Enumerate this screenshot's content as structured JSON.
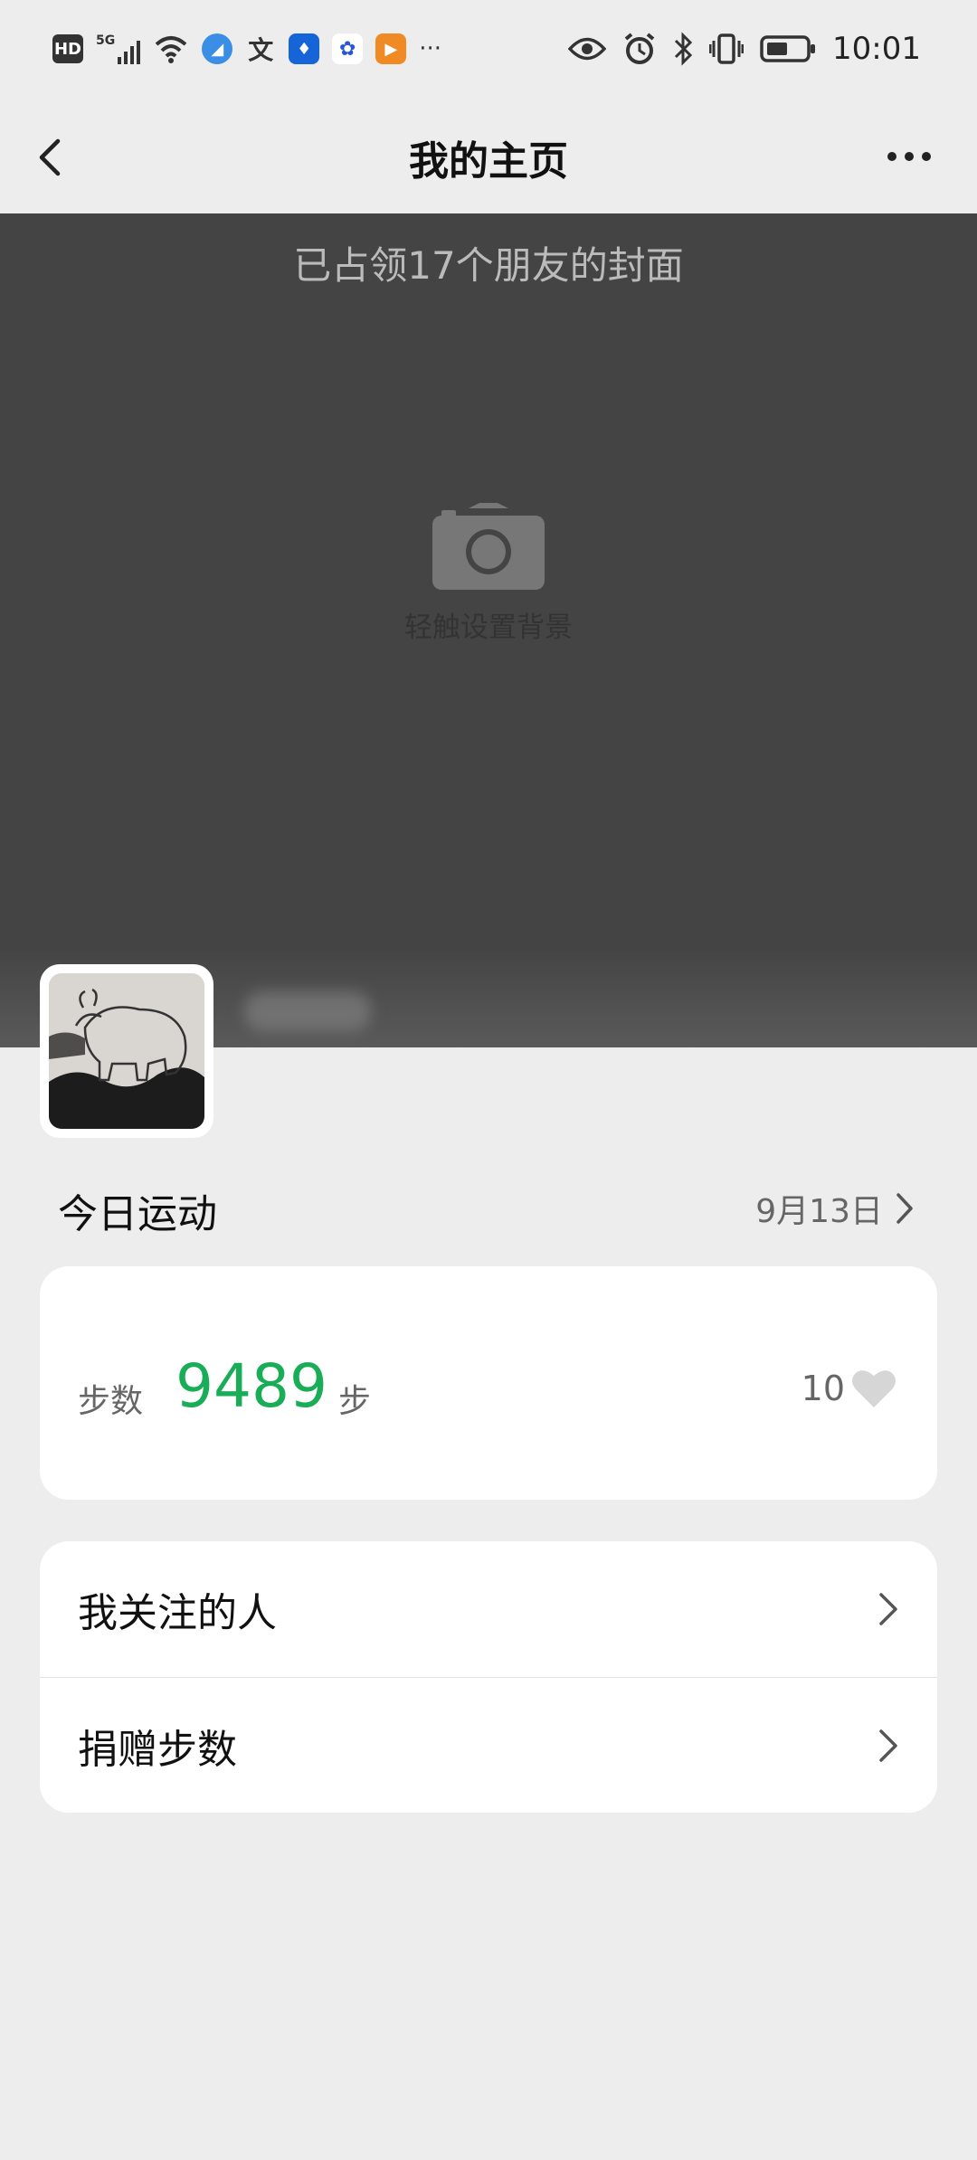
{
  "status_bar": {
    "network": "HD",
    "signal": "5G",
    "overflow": "···",
    "time": "10:01"
  },
  "nav": {
    "title": "我的主页"
  },
  "cover": {
    "occupied_text": "已占领17个朋友的封面",
    "set_background_hint": "轻触设置背景"
  },
  "today": {
    "title": "今日运动",
    "date": "9月13日"
  },
  "steps": {
    "label": "步数",
    "count": "9489",
    "unit": "步",
    "likes": "10"
  },
  "menu": {
    "items": [
      {
        "label": "我关注的人"
      },
      {
        "label": "捐赠步数"
      }
    ]
  },
  "colors": {
    "accent_green": "#1aad58",
    "background": "#ededed",
    "cover": "#444444"
  }
}
